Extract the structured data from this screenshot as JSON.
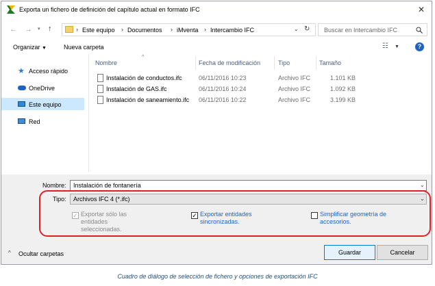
{
  "window": {
    "title": "Exporta un fichero de definición del capítulo actual en formato IFC"
  },
  "address": {
    "crumbs": [
      "Este equipo",
      "Documentos",
      "iMventa",
      "Intercambio IFC"
    ],
    "search_placeholder": "Buscar en Intercambio IFC"
  },
  "toolbar": {
    "organize": "Organizar",
    "new_folder": "Nueva carpeta"
  },
  "sidebar": {
    "items": [
      {
        "label": "Acceso rápido",
        "icon": "star-icon"
      },
      {
        "label": "OneDrive",
        "icon": "cloud-icon"
      },
      {
        "label": "Este equipo",
        "icon": "computer-icon"
      },
      {
        "label": "Red",
        "icon": "network-icon"
      }
    ]
  },
  "columns": {
    "name": "Nombre",
    "date": "Fecha de modificación",
    "type": "Tipo",
    "size": "Tamaño"
  },
  "files": [
    {
      "name": "Instalación de conductos.ifc",
      "date": "06/11/2016 10:23",
      "type": "Archivo IFC",
      "size": "1.101 KB"
    },
    {
      "name": "Instalación de GAS.ifc",
      "date": "06/11/2016 10:24",
      "type": "Archivo IFC",
      "size": "1.092 KB"
    },
    {
      "name": "Instalación de saneamiento.ifc",
      "date": "06/11/2016 10:22",
      "type": "Archivo IFC",
      "size": "3.199 KB"
    }
  ],
  "form": {
    "name_label": "Nombre:",
    "name_value": "Instalación de fontanería",
    "type_label": "Tipo:",
    "type_value": "Archivos IFC 4 (*.ifc)"
  },
  "options": {
    "export_selected": "Exportar sólo las entidades seleccionadas.",
    "export_synced": "Exportar entidades sincronizadas.",
    "simplify": "Simplificar geometría de accesorios."
  },
  "footer": {
    "hide_folders": "Ocultar carpetas",
    "save": "Guardar",
    "cancel": "Cancelar"
  },
  "caption": "Cuadro de diálogo de selección de fichero y opciones de exportación IFC",
  "colors": {
    "accent": "#0066cc",
    "highlight": "#e02020",
    "selection": "#cce8ff"
  }
}
